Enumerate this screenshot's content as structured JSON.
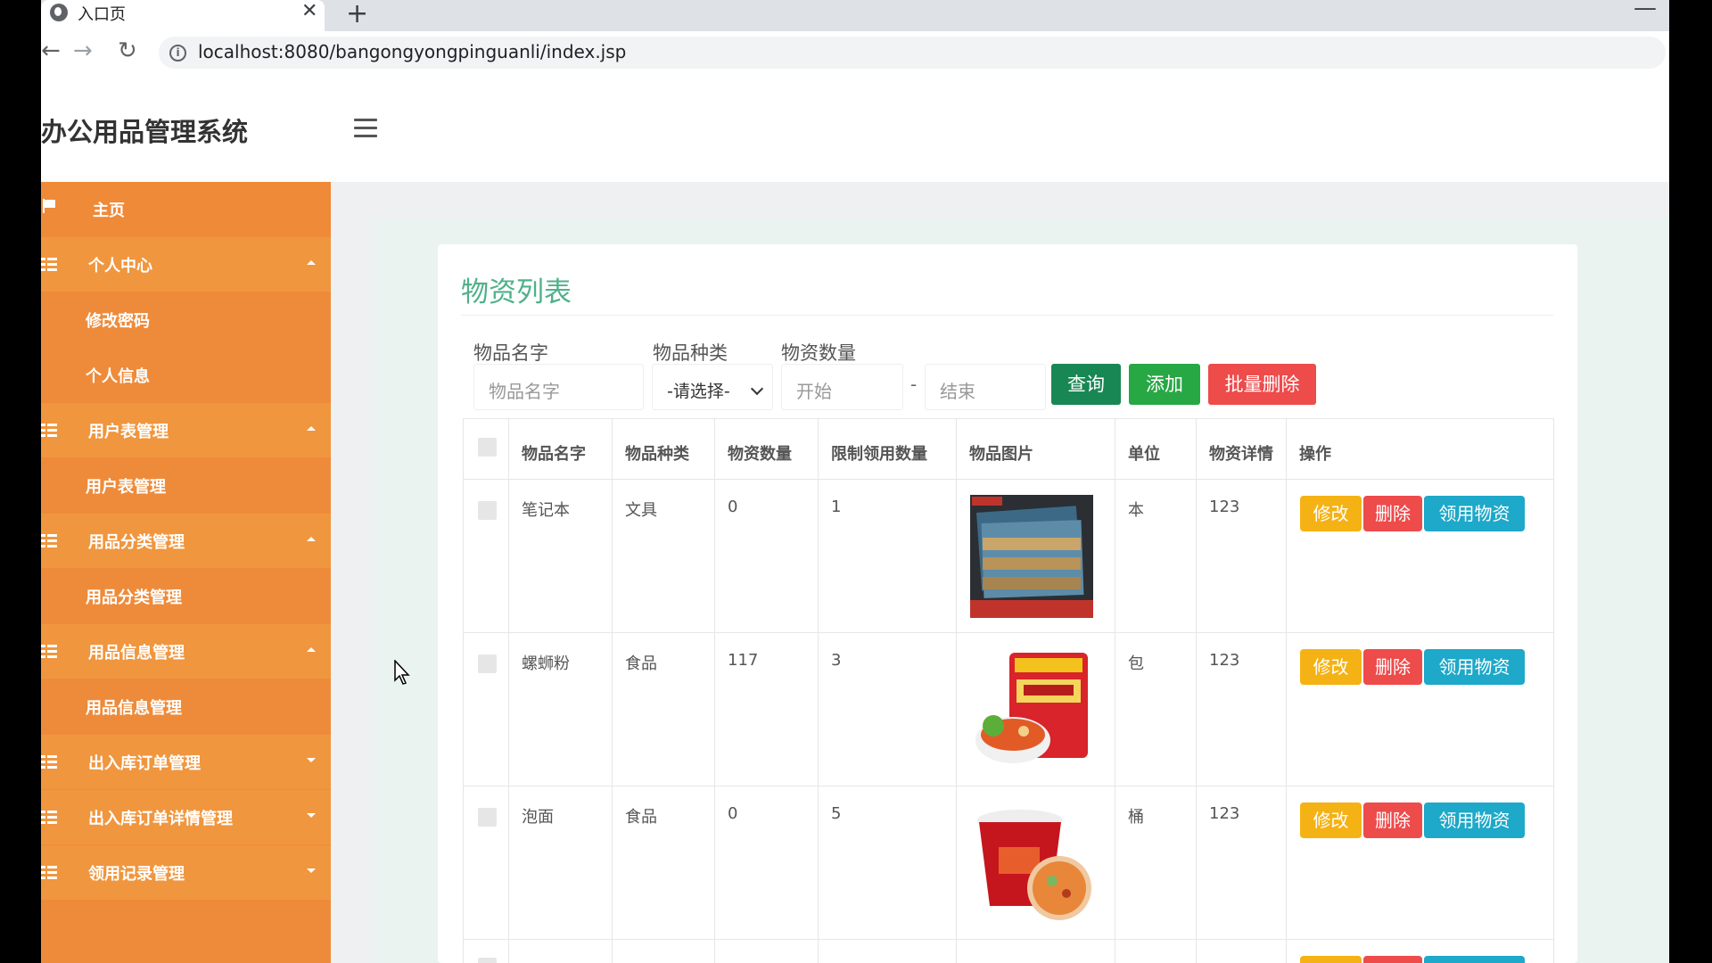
{
  "browser": {
    "tab_title": "入口页",
    "tab_close": "✕",
    "new_tab": "+",
    "minimize": "—",
    "url": "localhost:8080/bangongyongpinguanli/index.jsp",
    "nav_back": "←",
    "nav_forward": "→",
    "nav_reload": "↻"
  },
  "header": {
    "title": "办公用品管理系统"
  },
  "sidebar": {
    "home": "主页",
    "items": [
      {
        "label": "个人中心",
        "expanded": true,
        "children": [
          "修改密码",
          "个人信息"
        ]
      },
      {
        "label": "用户表管理",
        "expanded": true,
        "children": [
          "用户表管理"
        ]
      },
      {
        "label": "用品分类管理",
        "expanded": true,
        "children": [
          "用品分类管理"
        ]
      },
      {
        "label": "用品信息管理",
        "expanded": true,
        "children": [
          "用品信息管理"
        ]
      },
      {
        "label": "出入库订单管理",
        "expanded": false,
        "children": []
      },
      {
        "label": "出入库订单详情管理",
        "expanded": false,
        "children": []
      },
      {
        "label": "领用记录管理",
        "expanded": false,
        "children": []
      }
    ]
  },
  "page": {
    "title": "物资列表",
    "search": {
      "name_label": "物品名字",
      "name_placeholder": "物品名字",
      "type_label": "物品种类",
      "type_selected": "-请选择-",
      "qty_label": "物资数量",
      "qty_start_placeholder": "开始",
      "qty_dash": "-",
      "qty_end_placeholder": "结束",
      "query_btn": "查询",
      "add_btn": "添加",
      "batch_delete_btn": "批量删除"
    },
    "table": {
      "columns": [
        "物品名字",
        "物品种类",
        "物资数量",
        "限制领用数量",
        "物品图片",
        "单位",
        "物资详情",
        "操作"
      ],
      "rows": [
        {
          "name": "笔记本",
          "type": "文具",
          "qty": "0",
          "limit": "1",
          "unit": "本",
          "detail": "123",
          "image": "notebook-image"
        },
        {
          "name": "螺蛳粉",
          "type": "食品",
          "qty": "117",
          "limit": "3",
          "unit": "包",
          "detail": "123",
          "image": "noodle-pack-image"
        },
        {
          "name": "泡面",
          "type": "食品",
          "qty": "0",
          "limit": "5",
          "unit": "桶",
          "detail": "123",
          "image": "cup-noodle-image"
        }
      ],
      "actions": {
        "edit": "修改",
        "delete": "删除",
        "use": "领用物资"
      }
    }
  },
  "colors": {
    "sidebar": "#ee8b3a",
    "title_green": "#4fb18a",
    "edit": "#f5b214",
    "delete": "#ee4b4b",
    "use": "#1ea8c9",
    "query": "#198754",
    "add": "#28a745"
  }
}
